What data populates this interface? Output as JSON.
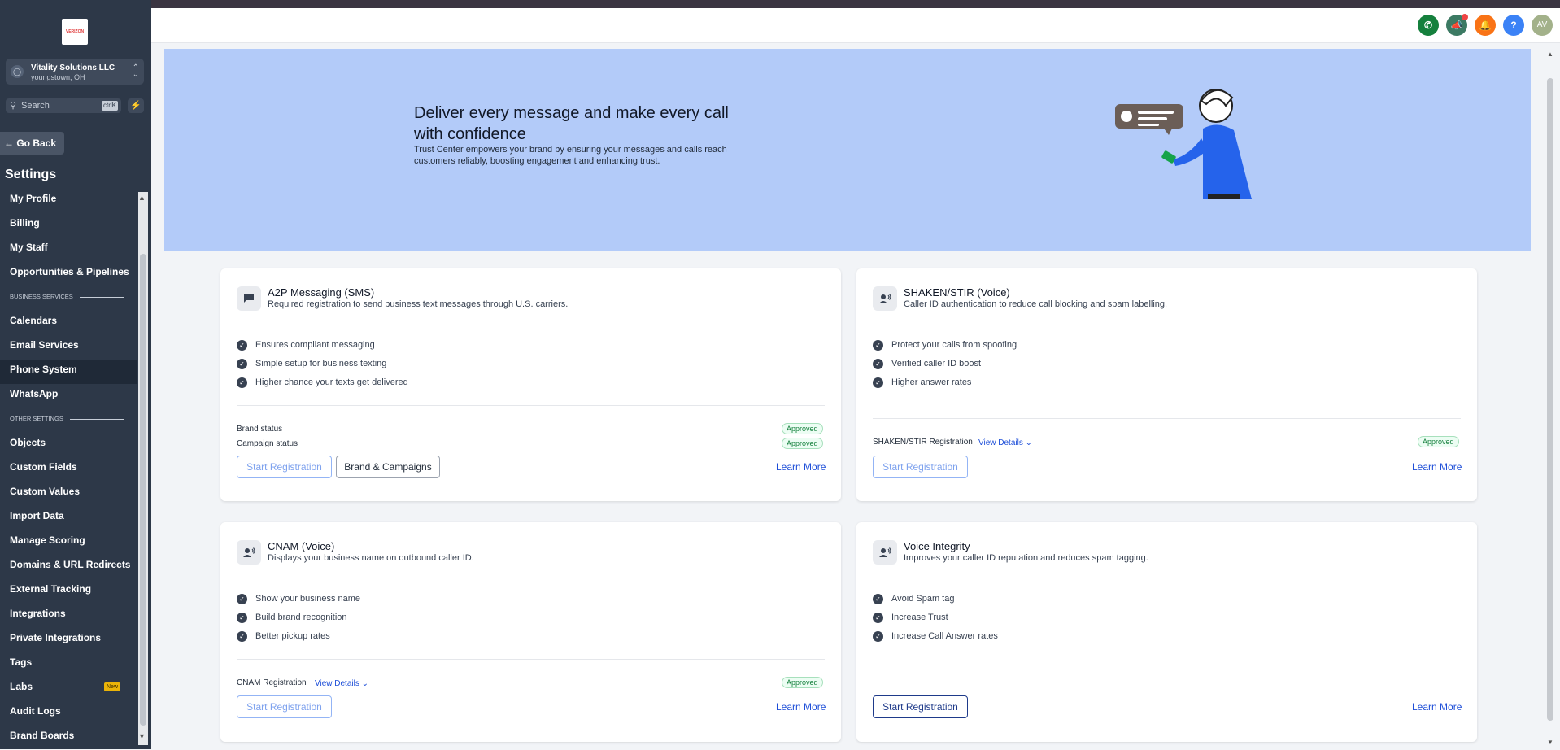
{
  "header": {
    "avatar_initials": "AV",
    "help_glyph": "?"
  },
  "sidebar": {
    "logo_text": "VERIZON",
    "account_name": "Vitality Solutions LLC",
    "account_location": "youngstown, OH",
    "search_placeholder": "Search",
    "search_shortcut": "ctrlK",
    "go_back": "Go Back",
    "settings_title": "Settings",
    "items": [
      {
        "label": "My Profile"
      },
      {
        "label": "Billing"
      },
      {
        "label": "My Staff"
      },
      {
        "label": "Opportunities & Pipelines"
      },
      {
        "section": "BUSINESS SERVICES"
      },
      {
        "label": "Calendars"
      },
      {
        "label": "Email Services"
      },
      {
        "label": "Phone System"
      },
      {
        "label": "WhatsApp"
      },
      {
        "section": "OTHER SETTINGS"
      },
      {
        "label": "Objects"
      },
      {
        "label": "Custom Fields"
      },
      {
        "label": "Custom Values"
      },
      {
        "label": "Import Data"
      },
      {
        "label": "Manage Scoring"
      },
      {
        "label": "Domains & URL Redirects"
      },
      {
        "label": "External Tracking"
      },
      {
        "label": "Integrations"
      },
      {
        "label": "Private Integrations"
      },
      {
        "label": "Tags"
      },
      {
        "label": "Labs",
        "badge": "New"
      },
      {
        "label": "Audit Logs"
      },
      {
        "label": "Brand Boards"
      }
    ]
  },
  "hero": {
    "title": "Deliver every message and make every call with confidence",
    "description": "Trust Center empowers your brand by ensuring your messages and calls reach customers reliably, boosting engagement and enhancing trust."
  },
  "cards": {
    "a2p": {
      "title": "A2P Messaging (SMS)",
      "subtitle": "Required registration to send business text messages through U.S. carriers.",
      "features": [
        "Ensures compliant messaging",
        "Simple setup for business texting",
        "Higher chance your texts get delivered"
      ],
      "brand_status_label": "Brand status",
      "brand_status": "Approved",
      "campaign_status_label": "Campaign status",
      "campaign_status": "Approved",
      "start_btn": "Start Registration",
      "brand_btn": "Brand & Campaigns",
      "learn_more": "Learn More"
    },
    "shaken": {
      "title": "SHAKEN/STIR (Voice)",
      "subtitle": "Caller ID authentication to reduce call blocking and spam labelling.",
      "features": [
        "Protect your calls from spoofing",
        "Verified caller ID boost",
        "Higher answer rates"
      ],
      "reg_label": "SHAKEN/STIR Registration",
      "view_details": "View Details",
      "status": "Approved",
      "start_btn": "Start Registration",
      "learn_more": "Learn More"
    },
    "cnam": {
      "title": "CNAM (Voice)",
      "subtitle": "Displays your business name on outbound caller ID.",
      "features": [
        "Show your business name",
        "Build brand recognition",
        "Better pickup rates"
      ],
      "reg_label": "CNAM Registration",
      "view_details": "View Details",
      "status": "Approved",
      "start_btn": "Start Registration",
      "learn_more": "Learn More"
    },
    "voice_integrity": {
      "title": "Voice Integrity",
      "subtitle": "Improves your caller ID reputation and reduces spam tagging.",
      "features": [
        "Avoid Spam tag",
        "Increase Trust",
        "Increase Call Answer rates"
      ],
      "start_btn": "Start Registration",
      "learn_more": "Learn More"
    }
  },
  "colors": {
    "sidebar_bg": "#2d3848",
    "hero_bg": "#b3cbf9",
    "link_blue": "#1d4ed8",
    "approved_green": "#15803d"
  }
}
